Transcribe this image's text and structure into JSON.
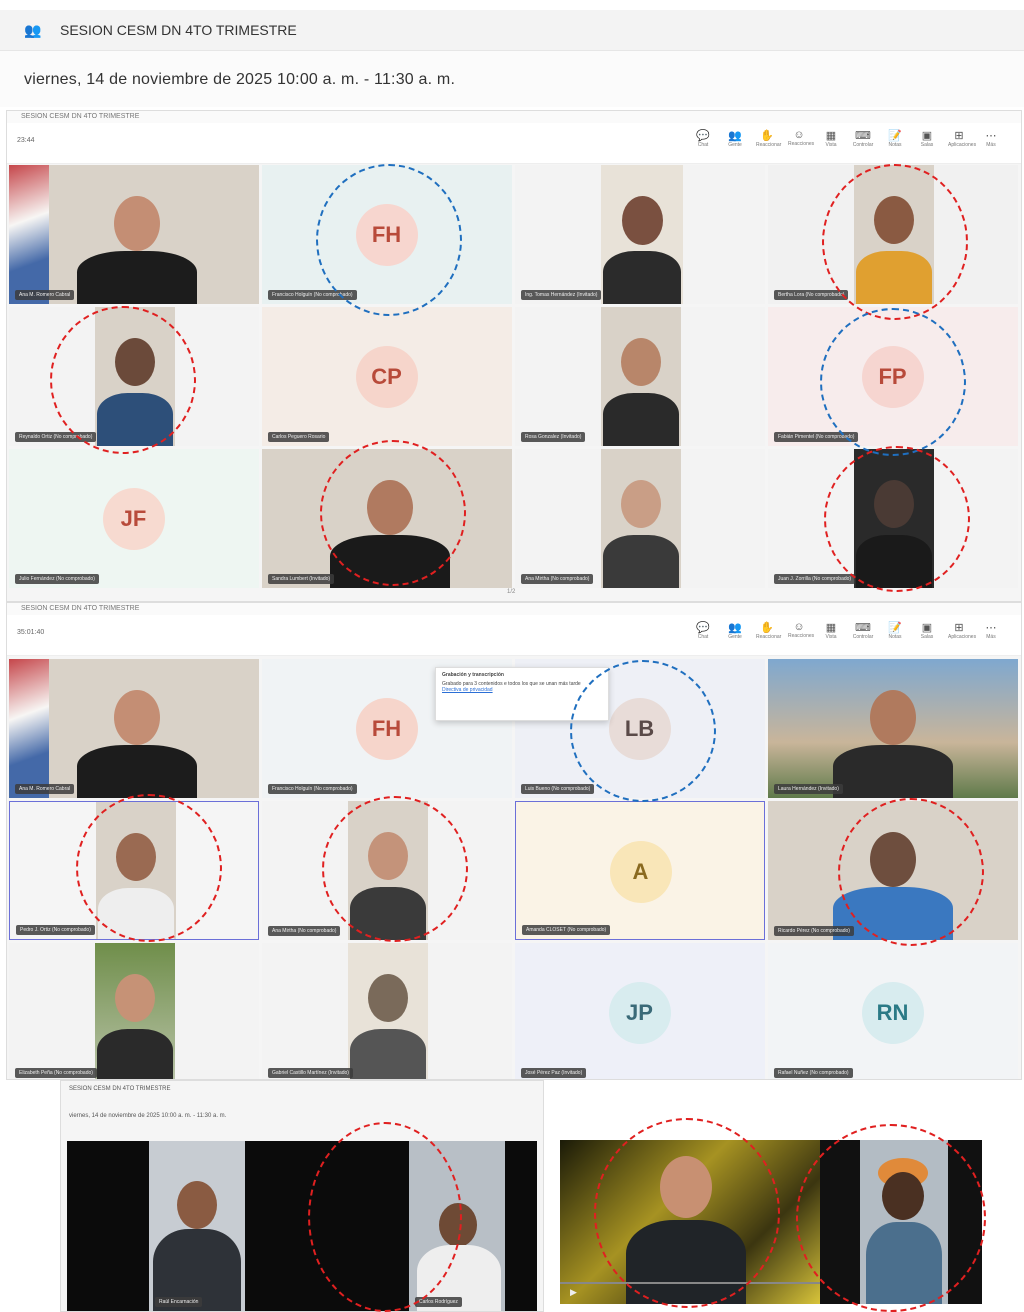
{
  "header": {
    "app_icon": "teams-people-icon",
    "title": "SESION CESM DN 4TO TRIMESTRE",
    "datetime": "viernes, 14 de noviembre de 2025 10:00 a. m. - 11:30 a. m."
  },
  "panel1": {
    "title": "SESION CESM DN 4TO TRIMESTRE",
    "timer": "23:44",
    "toolbar": [
      "Chat",
      "Gente",
      "Reaccionar",
      "Reacciones",
      "Vista",
      "Controlar",
      "Notas",
      "Salas",
      "Aplicaciones",
      "Más"
    ],
    "pager": "1/2",
    "tiles": [
      {
        "initials": "",
        "name": "Ana M. Romero Cabral"
      },
      {
        "initials": "FH",
        "name": "Francisco Holguín (No comprobado)"
      },
      {
        "initials": "",
        "name": "Ing. Tomas Hernández (Invitado)"
      },
      {
        "initials": "",
        "name": "Bertha Lora (No comprobado)"
      },
      {
        "initials": "",
        "name": "Reynaldo Ortiz (No comprobado)"
      },
      {
        "initials": "CP",
        "name": "Carlos Peguero Rosario"
      },
      {
        "initials": "",
        "name": "Rosa Gonzalez (Invitado)"
      },
      {
        "initials": "FP",
        "name": "Fabián Pimentel (No comprobado)"
      },
      {
        "initials": "JF",
        "name": "Julio Fernández (No comprobado)"
      },
      {
        "initials": "",
        "name": "Sandra Lumbert (Invitado)"
      },
      {
        "initials": "",
        "name": "Ana Mirtha (No comprobado)"
      },
      {
        "initials": "",
        "name": "Juan J. Zorrilla (No comprobado)"
      }
    ]
  },
  "panel2": {
    "title": "SESION CESM DN 4TO TRIMESTRE",
    "timer": "35:01:40",
    "toolbar": [
      "Chat",
      "Gente",
      "Reaccionar",
      "Reacciones",
      "Vista",
      "Controlar",
      "Notas",
      "Salas",
      "Aplicaciones",
      "Más"
    ],
    "popup": {
      "title": "Grabación y transcripción",
      "body": "Grabado para 3 contenidos e todos los que se unan más tarde",
      "link": "Directiva de privacidad"
    },
    "tiles": [
      {
        "initials": "",
        "name": "Ana M. Romero Cabral"
      },
      {
        "initials": "FH",
        "name": "Francisco Holguín (No comprobado)"
      },
      {
        "initials": "LB",
        "name": "Luis Bueno (No comprobado)"
      },
      {
        "initials": "",
        "name": "Laura Hernández (Invitado)"
      },
      {
        "initials": "",
        "name": "Pedro J. Ortiz (No comprobado)"
      },
      {
        "initials": "",
        "name": "Ana Mirtha (No comprobado)"
      },
      {
        "initials": "A",
        "name": "Amanda CLOSET (No comprobado)"
      },
      {
        "initials": "",
        "name": "Ricardo Pérez (No comprobado)"
      },
      {
        "initials": "",
        "name": "Elizabeth Peña (No comprobado)"
      },
      {
        "initials": "",
        "name": "Gabriel Castillo Martínez (Invitado)"
      },
      {
        "initials": "JP",
        "name": "José Pérez Paz (Invitado)"
      },
      {
        "initials": "RN",
        "name": "Rafael Nuñez (No comprobado)"
      }
    ]
  },
  "panel3": {
    "title": "SESION CESM DN 4TO TRIMESTRE",
    "datetime": "viernes, 14 de noviembre de 2025 10:00 a. m. - 11:30 a. m.",
    "tiles": [
      {
        "name": "Raúl Encarnación"
      },
      {
        "name": "Carlos Rodríguez"
      }
    ]
  },
  "colors": {
    "accent": "#5b5fc7",
    "ring_red": "#e02020",
    "ring_blue": "#1f6fbf"
  }
}
